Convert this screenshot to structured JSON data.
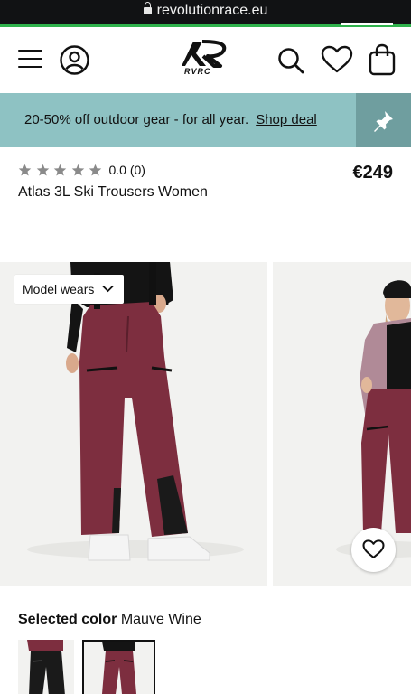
{
  "browser": {
    "url": "revolutionrace.eu"
  },
  "header": {
    "logo_text": "RVRC",
    "icons": [
      "menu-icon",
      "account-icon",
      "brand-logo",
      "search-icon",
      "heart-icon",
      "bag-icon"
    ]
  },
  "promo": {
    "text": "20-50% off outdoor gear - for all year.",
    "link_label": "Shop deal",
    "icon": "pin-icon",
    "background": "#8ec2c3"
  },
  "product": {
    "rating_value": "0.0 (0)",
    "stars_filled": 0,
    "stars_total": 5,
    "price": "€249",
    "title": "Atlas 3L Ski Trousers Women"
  },
  "gallery": {
    "model_wears_label": "Model wears",
    "product_color": "#7d2e3f"
  },
  "color_selector": {
    "label": "Selected color",
    "value": "Mauve Wine",
    "options": [
      "Black",
      "Mauve Wine"
    ],
    "selected_index": 1
  }
}
